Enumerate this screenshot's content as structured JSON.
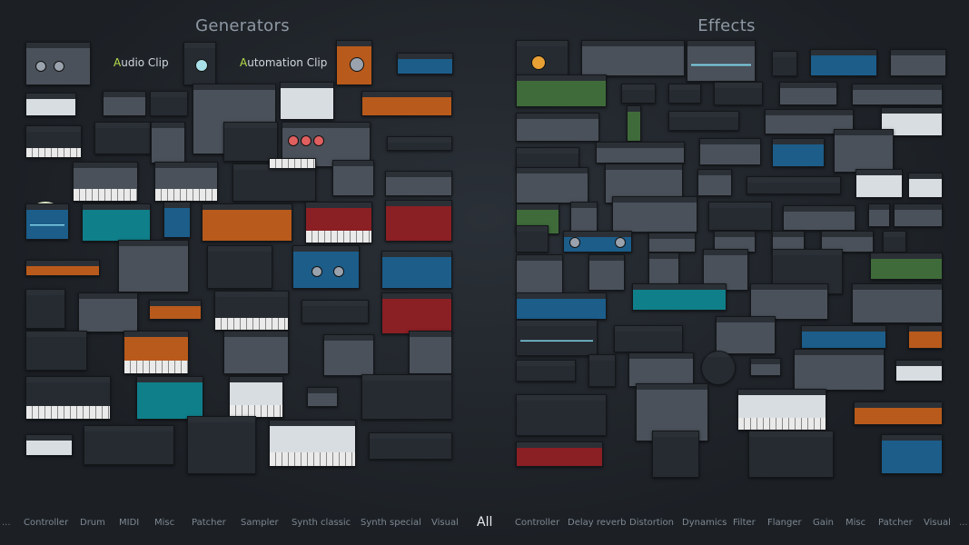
{
  "headings": {
    "generators": "Generators",
    "effects": "Effects"
  },
  "labels": {
    "audio_clip": {
      "first": "A",
      "rest": "udio Clip"
    },
    "automation_clip": {
      "first": "A",
      "rest": "utomation Clip"
    }
  },
  "categories": {
    "generators": [
      "Controller",
      "Drum",
      "MIDI",
      "Misc",
      "Patcher",
      "Sampler",
      "Synth classic",
      "Synth special",
      "Visual"
    ],
    "all": "All",
    "effects": [
      "Controller",
      "Delay reverb",
      "Distortion",
      "Dynamics",
      "Filter",
      "Flanger",
      "Gain",
      "Misc",
      "Patcher",
      "Visual"
    ],
    "ellipsis": "..."
  },
  "icons": {
    "anime_mascot": "mascot-icon"
  }
}
